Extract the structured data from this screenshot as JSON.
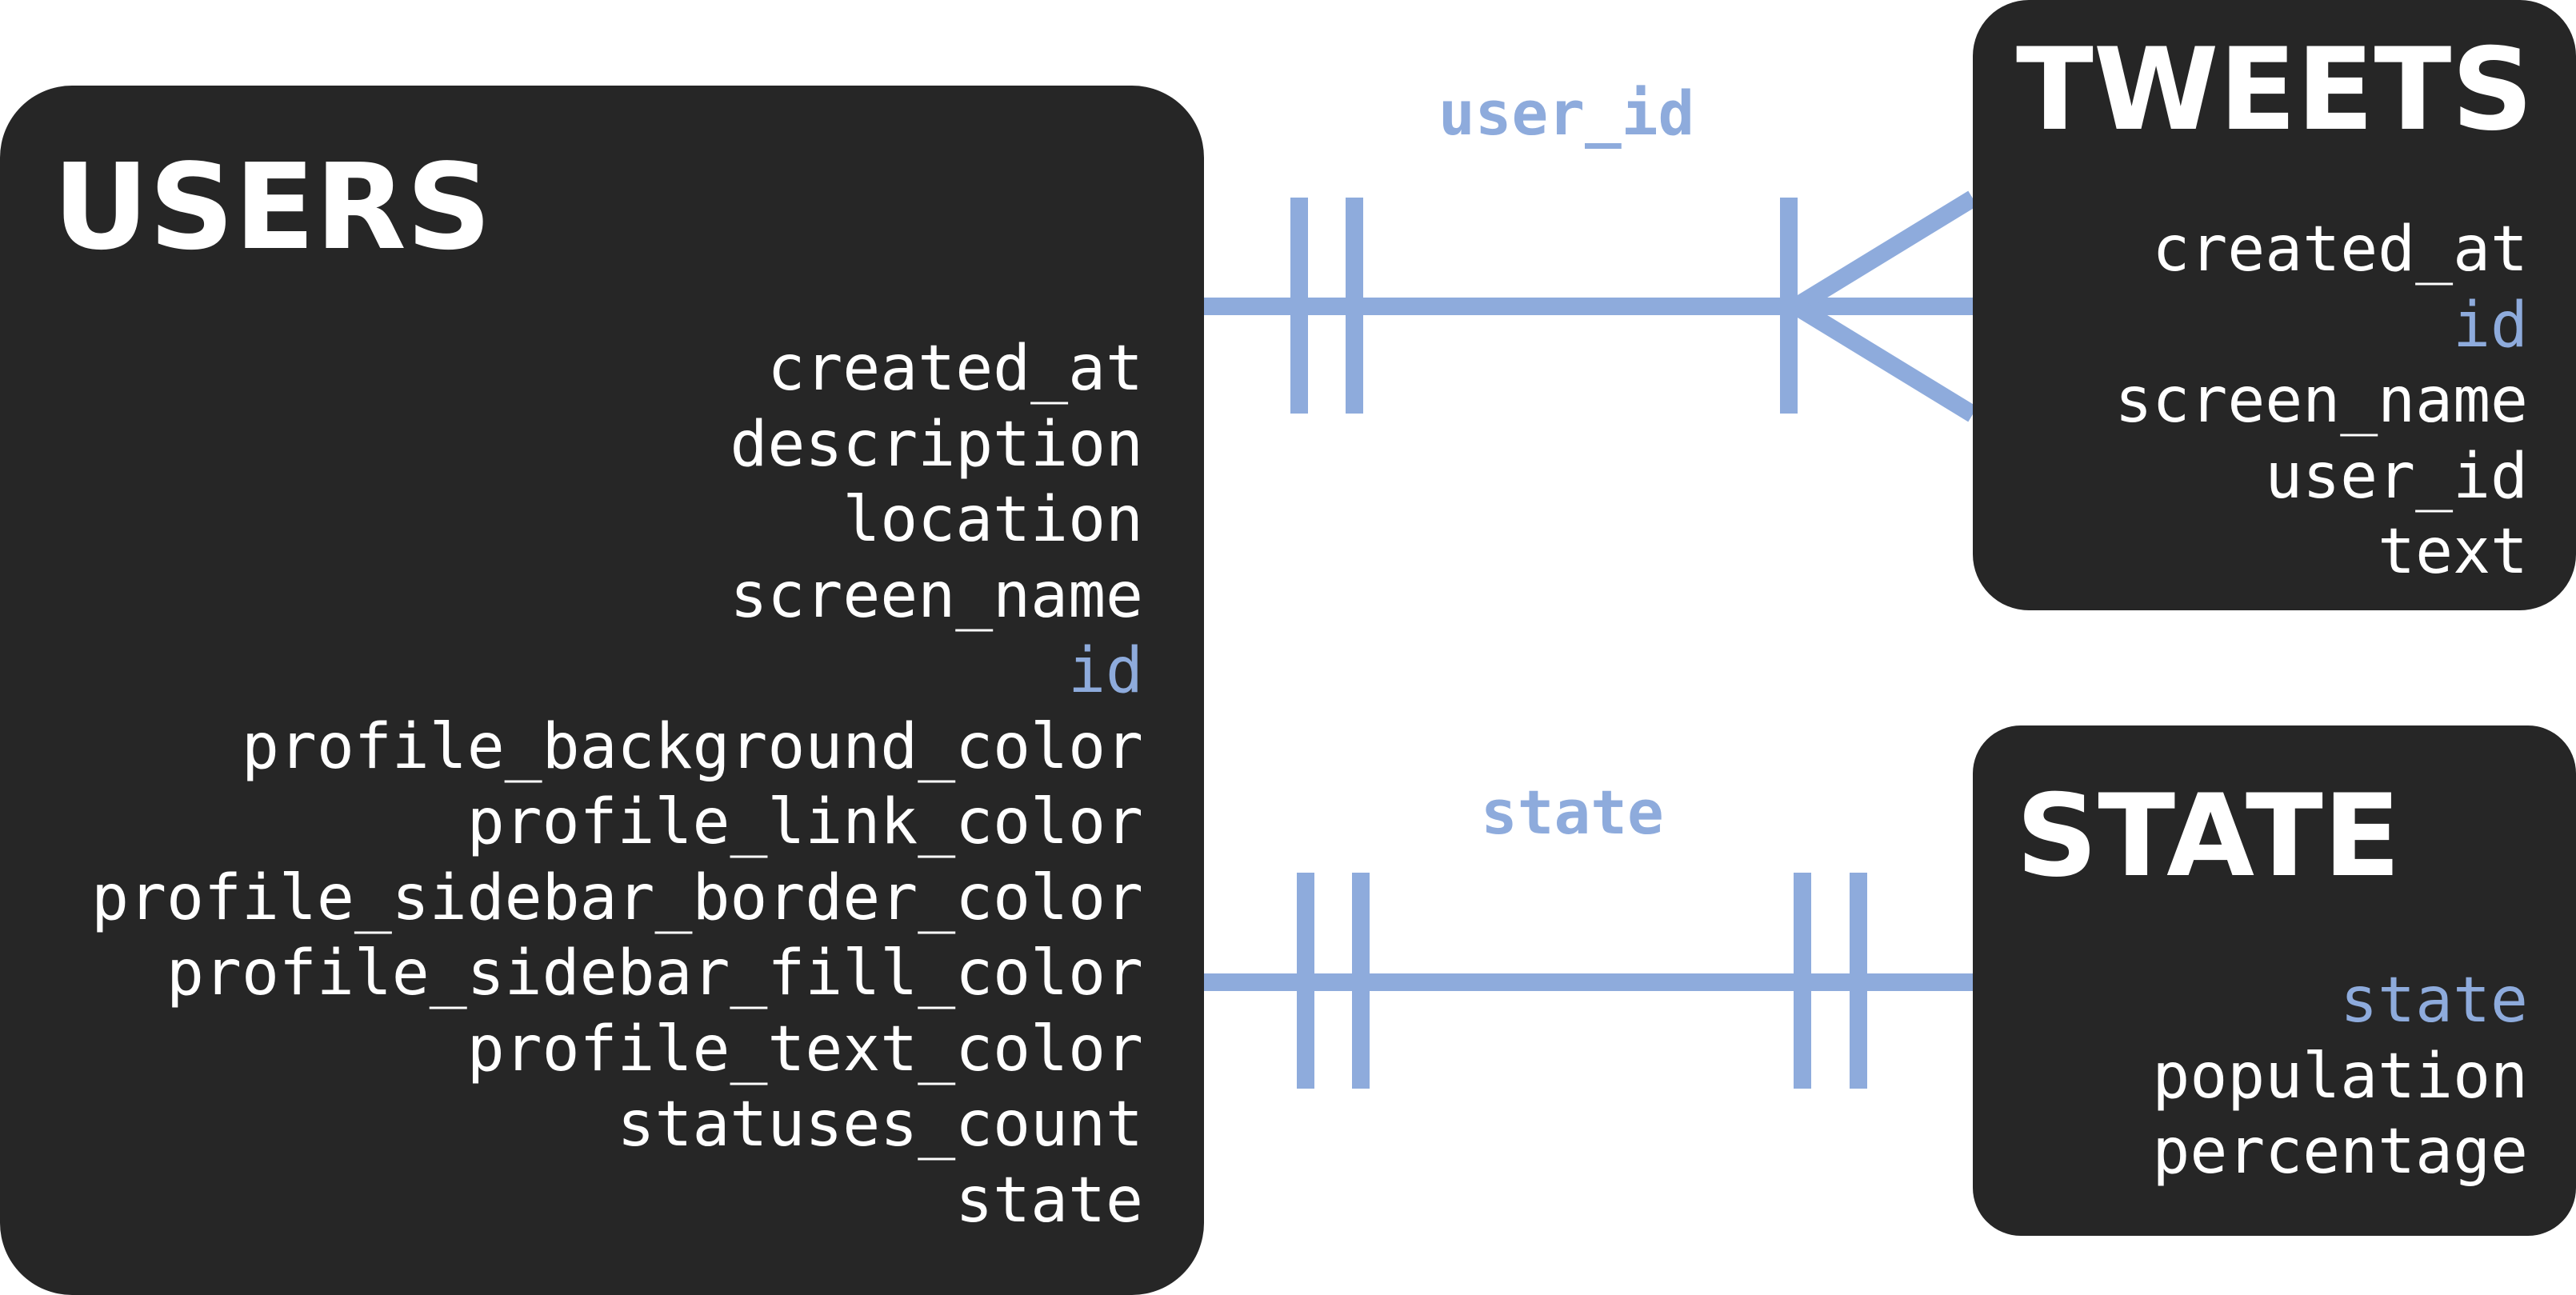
{
  "colors": {
    "box_fill": "#262626",
    "field_text": "#ffffff",
    "key_field_text": "#8eabdc",
    "connector": "#8eabdc",
    "background": "#ffffff"
  },
  "tables": {
    "users": {
      "title": "USERS",
      "fields": [
        {
          "name": "created_at",
          "key": false
        },
        {
          "name": "description",
          "key": false
        },
        {
          "name": "location",
          "key": false
        },
        {
          "name": "screen_name",
          "key": false
        },
        {
          "name": "id",
          "key": true
        },
        {
          "name": "profile_background_color",
          "key": false
        },
        {
          "name": "profile_link_color",
          "key": false
        },
        {
          "name": "profile_sidebar_border_color",
          "key": false
        },
        {
          "name": "profile_sidebar_fill_color",
          "key": false
        },
        {
          "name": "profile_text_color",
          "key": false
        },
        {
          "name": "statuses_count",
          "key": false
        },
        {
          "name": "state",
          "key": false
        }
      ]
    },
    "tweets": {
      "title": "TWEETS",
      "fields": [
        {
          "name": "created_at",
          "key": false
        },
        {
          "name": "id",
          "key": true
        },
        {
          "name": "screen_name",
          "key": false
        },
        {
          "name": "user_id",
          "key": false
        },
        {
          "name": "text",
          "key": false
        }
      ]
    },
    "state": {
      "title": "STATE",
      "fields": [
        {
          "name": "state",
          "key": true
        },
        {
          "name": "population",
          "key": false
        },
        {
          "name": "percentage",
          "key": false
        }
      ]
    }
  },
  "relationships": {
    "users_tweets": {
      "label": "user_id",
      "from": "USERS",
      "to": "TWEETS",
      "cardinality": "one-to-many"
    },
    "users_state": {
      "label": "state",
      "from": "USERS",
      "to": "STATE",
      "cardinality": "one-to-one"
    }
  }
}
